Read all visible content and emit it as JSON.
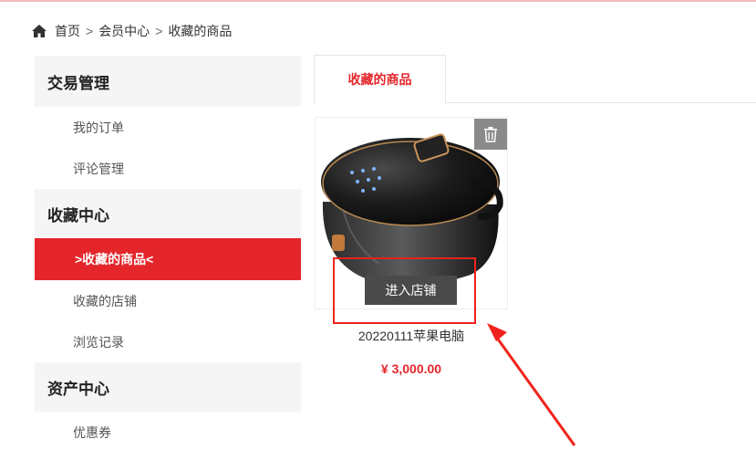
{
  "breadcrumb": {
    "home": "首页",
    "separator": ">",
    "member_center": "会员中心",
    "current": "收藏的商品"
  },
  "sidebar": {
    "groups": [
      {
        "title": "交易管理",
        "items": [
          "我的订单",
          "评论管理"
        ]
      },
      {
        "title": "收藏中心",
        "items": [
          ">收藏的商品<",
          "收藏的店铺",
          "浏览记录"
        ]
      },
      {
        "title": "资产中心",
        "items": [
          "优惠券"
        ]
      }
    ],
    "active_item": ">收藏的商品<"
  },
  "tabs": {
    "active": "收藏的商品"
  },
  "product": {
    "name": "20220111苹果电脑",
    "price": "¥ 3,000.00",
    "enter_shop_label": "进入店铺",
    "delete_icon": "trash-icon"
  },
  "colors": {
    "accent": "#e4262b",
    "annotation": "#f0231c",
    "sidebar_bg": "#f5f5f5"
  }
}
